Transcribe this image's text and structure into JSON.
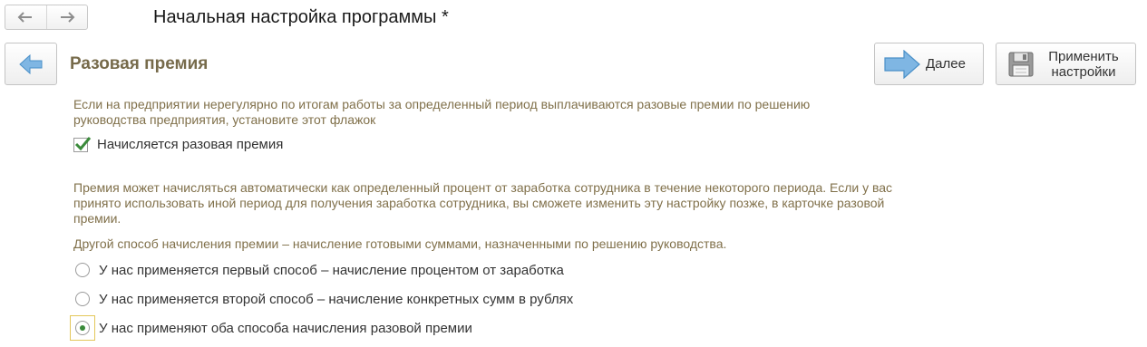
{
  "window": {
    "title": "Начальная настройка программы *"
  },
  "navigation": {
    "back_icon": "arrow-left-icon",
    "forward_icon": "arrow-right-icon"
  },
  "section": {
    "title": "Разовая премия"
  },
  "toolbar": {
    "next_label": "Далее",
    "apply_label_line1": "Применить",
    "apply_label_line2": "настройки"
  },
  "content": {
    "hint_1": "Если на предприятии нерегулярно по итогам работы за определенный период выплачиваются разовые премии по решению руководства предприятия, установите этот флажок",
    "checkbox": {
      "label": "Начисляется разовая премия",
      "checked": true
    },
    "hint_2": "Премия может начисляться автоматически как определенный процент от заработка сотрудника в течение некоторого периода. Если у вас принято использовать иной период для получения заработка сотрудника, вы сможете изменить эту настройку позже, в карточке разовой премии.",
    "hint_3": "Другой способ начисления премии – начисление готовыми суммами, назначенными по решению руководства.",
    "options": [
      {
        "label": "У нас применяется первый способ – начисление процентом от заработка",
        "selected": false
      },
      {
        "label": "У нас применяется второй способ – начисление конкретных сумм в рублях",
        "selected": false
      },
      {
        "label": "У нас применяют оба способа начисления разовой премии",
        "selected": true
      }
    ]
  },
  "colors": {
    "hint_text": "#80704a",
    "section_title": "#776b4b",
    "accent_blue": "#4a90c8",
    "check_green": "#3a8a3a",
    "focus_outline": "#e3c75a"
  }
}
